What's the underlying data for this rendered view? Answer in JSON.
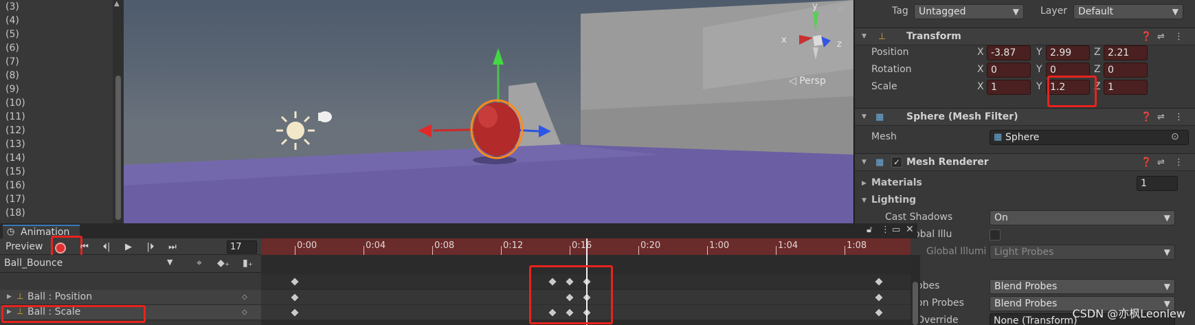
{
  "hierarchy": {
    "items": [
      "(3)",
      "(4)",
      "(5)",
      "(6)",
      "(7)",
      "(8)",
      "(9)",
      "(10)",
      "(11)",
      "(12)",
      "(13)",
      "(14)",
      "(15)",
      "(16)",
      "(17)",
      "(18)"
    ]
  },
  "scene": {
    "gizmo_x": "x",
    "gizmo_y": "y",
    "gizmo_z": "z",
    "projection": "◁ Persp"
  },
  "inspector": {
    "tag_label": "Tag",
    "tag_value": "Untagged",
    "layer_label": "Layer",
    "layer_value": "Default",
    "transform": {
      "title": "Transform",
      "position": {
        "label": "Position",
        "x": "-3.87",
        "y": "2.99",
        "z": "2.21"
      },
      "rotation": {
        "label": "Rotation",
        "x": "0",
        "y": "0",
        "z": "0"
      },
      "scale": {
        "label": "Scale",
        "x": "1",
        "y": "1.2",
        "z": "1"
      }
    },
    "mesh_filter": {
      "title": "Sphere (Mesh Filter)",
      "mesh_label": "Mesh",
      "mesh_value": "Sphere"
    },
    "mesh_renderer": {
      "title": "Mesh Renderer",
      "materials_label": "Materials",
      "materials_count": "1",
      "lighting_label": "Lighting",
      "cast_shadows_label": "Cast Shadows",
      "cast_shadows_value": "On",
      "contribute_gi_label": "ute Global Illu",
      "receive_gi_label": "Global Illumi",
      "receive_gi_value": "Light Probes",
      "light_probes_label": "obes",
      "light_probes_value": "Blend Probes",
      "reflection_probes_label": "on Probes",
      "reflection_probes_value": "Blend Probes",
      "anchor_override_label": "Override",
      "anchor_override_value": "None (Transform)"
    },
    "xyz": {
      "x": "X",
      "y": "Y",
      "z": "Z"
    }
  },
  "animation": {
    "tab_label": "Animation",
    "preview_label": "Preview",
    "frame": "17",
    "clip_name": "Ball_Bounce",
    "ticks": [
      "0:00",
      "0:04",
      "0:08",
      "0:12",
      "0:16",
      "0:20",
      "1:00",
      "1:04",
      "1:08"
    ],
    "properties": [
      {
        "label": "Ball : Position"
      },
      {
        "label": "Ball : Scale"
      }
    ],
    "summary_keys": [
      0,
      15,
      16,
      17,
      34
    ],
    "position_keys": [
      0,
      16,
      17,
      34
    ],
    "scale_keys": [
      0,
      15,
      16,
      17,
      34
    ]
  },
  "watermark": "CSDN @亦枫Leonlew",
  "colors": {
    "highlight_box": "#e8231d",
    "record_red": "#e03030",
    "timeline_ruler": "#6a2b2b",
    "animated_field": "#4a2020"
  }
}
